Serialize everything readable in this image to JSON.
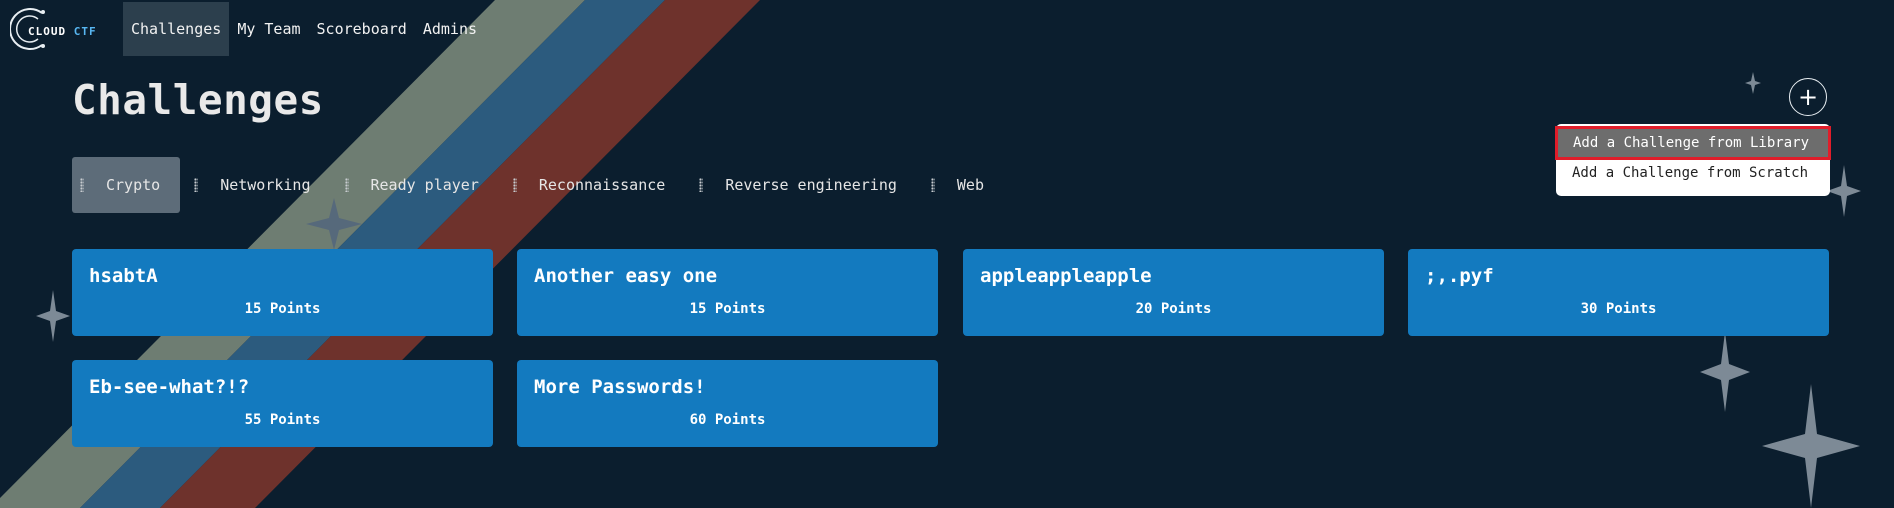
{
  "app": {
    "logo_text_a": "CLOUD",
    "logo_text_b": "CTF"
  },
  "nav": {
    "items": [
      {
        "label": "Challenges",
        "active": true
      },
      {
        "label": "My Team",
        "active": false
      },
      {
        "label": "Scoreboard",
        "active": false
      },
      {
        "label": "Admins",
        "active": false
      }
    ]
  },
  "page": {
    "title": "Challenges"
  },
  "categories": [
    {
      "label": "Crypto",
      "active": true
    },
    {
      "label": "Networking",
      "active": false
    },
    {
      "label": "Ready player",
      "active": false
    },
    {
      "label": "Reconnaissance",
      "active": false
    },
    {
      "label": "Reverse engineering",
      "active": false
    },
    {
      "label": "Web",
      "active": false
    }
  ],
  "add_menu": {
    "button_label": "+",
    "items": [
      {
        "label": "Add a Challenge from Library",
        "highlighted": true
      },
      {
        "label": "Add a Challenge from Scratch",
        "highlighted": false
      }
    ]
  },
  "challenges": [
    {
      "name": "hsabtA",
      "points": "15 Points"
    },
    {
      "name": "Another easy one",
      "points": "15 Points"
    },
    {
      "name": "appleappleapple",
      "points": "20 Points"
    },
    {
      "name": ";,.pyf",
      "points": "30 Points"
    },
    {
      "name": "Eb-see-what?!?",
      "points": "55 Points"
    },
    {
      "name": "More Passwords!",
      "points": "60 Points"
    }
  ],
  "colors": {
    "background": "#0b1e2e",
    "card": "#137abf",
    "stripe_gray": "#6e7d72",
    "stripe_blue": "#2c5b7e",
    "stripe_red": "#6e322c",
    "highlight_outline": "#e01d2a"
  }
}
